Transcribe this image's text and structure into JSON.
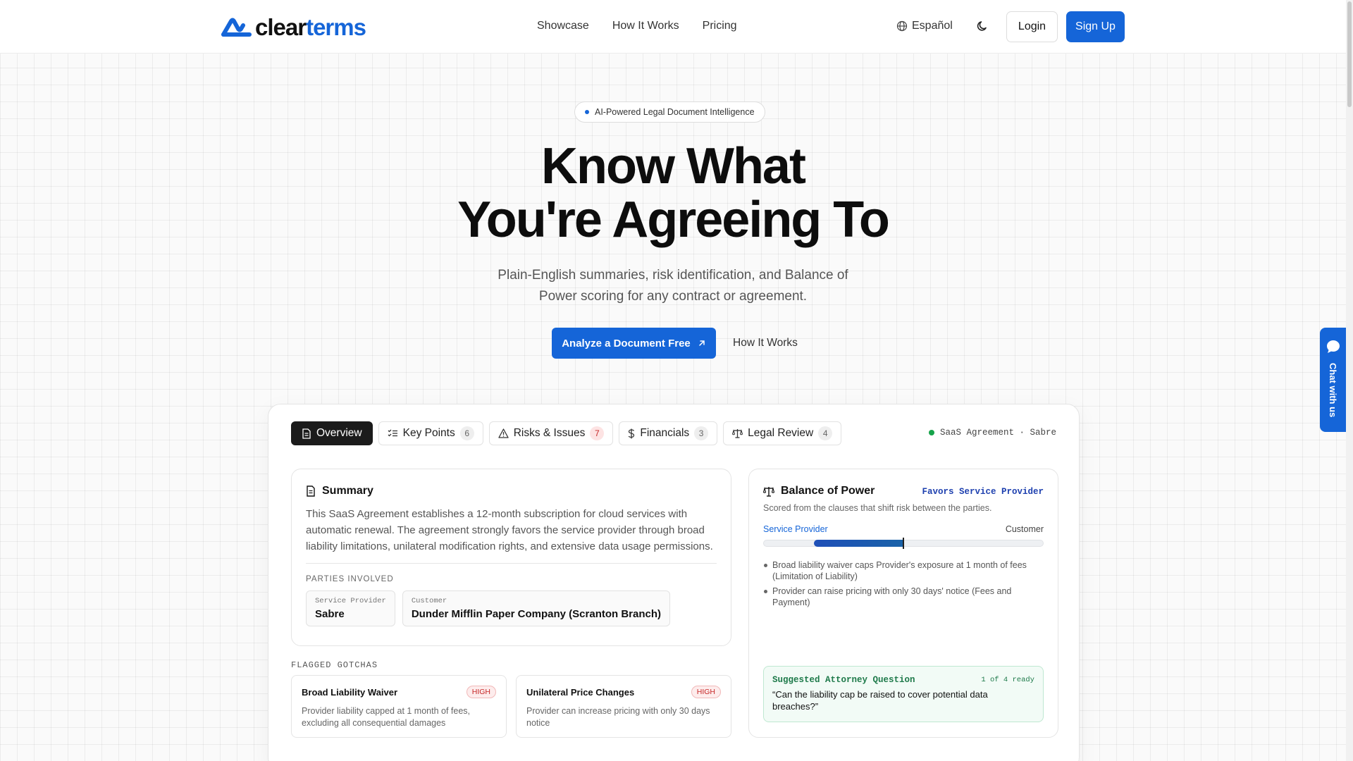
{
  "brand": {
    "name_dark": "clear",
    "name_blue": "terms",
    "accent": "#1565d8"
  },
  "nav": {
    "items": [
      "Showcase",
      "How It Works",
      "Pricing"
    ]
  },
  "header": {
    "language": "Español",
    "login": "Login",
    "signup": "Sign Up"
  },
  "hero": {
    "badge": "AI-Powered Legal Document Intelligence",
    "title_line1": "Know What",
    "title_line2": "You're Agreeing To",
    "subtitle": "Plain-English summaries, risk identification, and Balance of Power scoring for any contract or agreement.",
    "cta_primary": "Analyze a Document Free",
    "cta_secondary": "How It Works"
  },
  "chat": {
    "label": "Chat with us"
  },
  "demo": {
    "tabs": [
      {
        "label": "Overview",
        "count": "",
        "icon": "document-icon",
        "active": true
      },
      {
        "label": "Key Points",
        "count": "6",
        "icon": "list-check-icon"
      },
      {
        "label": "Risks & Issues",
        "count": "7",
        "icon": "warning-icon"
      },
      {
        "label": "Financials",
        "count": "3",
        "icon": "dollar-icon"
      },
      {
        "label": "Legal Review",
        "count": "4",
        "icon": "scale-icon"
      }
    ],
    "doc_meta": "SaaS Agreement · Sabre",
    "summary": {
      "title": "Summary",
      "text": "This SaaS Agreement establishes a 12-month subscription for cloud services with automatic renewal. The agreement strongly favors the service provider through broad liability limitations, unilateral modification rights, and extensive data usage permissions.",
      "parties_label": "PARTIES INVOLVED",
      "parties": [
        {
          "role": "Service Provider",
          "name": "Sabre"
        },
        {
          "role": "Customer",
          "name": "Dunder Mifflin Paper Company (Scranton Branch)"
        }
      ]
    },
    "gotchas": {
      "label": "FLAGGED GOTCHAS",
      "items": [
        {
          "title": "Broad Liability Waiver",
          "level": "HIGH",
          "desc": "Provider liability capped at 1 month of fees, excluding all consequential damages"
        },
        {
          "title": "Unilateral Price Changes",
          "level": "HIGH",
          "desc": "Provider can increase pricing with only 30 days notice"
        }
      ]
    },
    "balance": {
      "title": "Balance of Power",
      "favors": "Favors Service Provider",
      "subtitle": "Scored from the clauses that shift risk between the parties.",
      "left_label": "Service Provider",
      "right_label": "Customer",
      "bar_start": 0.18,
      "bar_end": 0.5,
      "points": [
        "Broad liability waiver caps Provider's exposure at 1 month of fees (Limitation of Liability)",
        "Provider can raise pricing with only 30 days' notice (Fees and Payment)"
      ],
      "question": {
        "title": "Suggested Attorney Question",
        "ready": "1 of 4 ready",
        "text": "“Can the liability cap be raised to cover potential data breaches?”"
      }
    }
  }
}
